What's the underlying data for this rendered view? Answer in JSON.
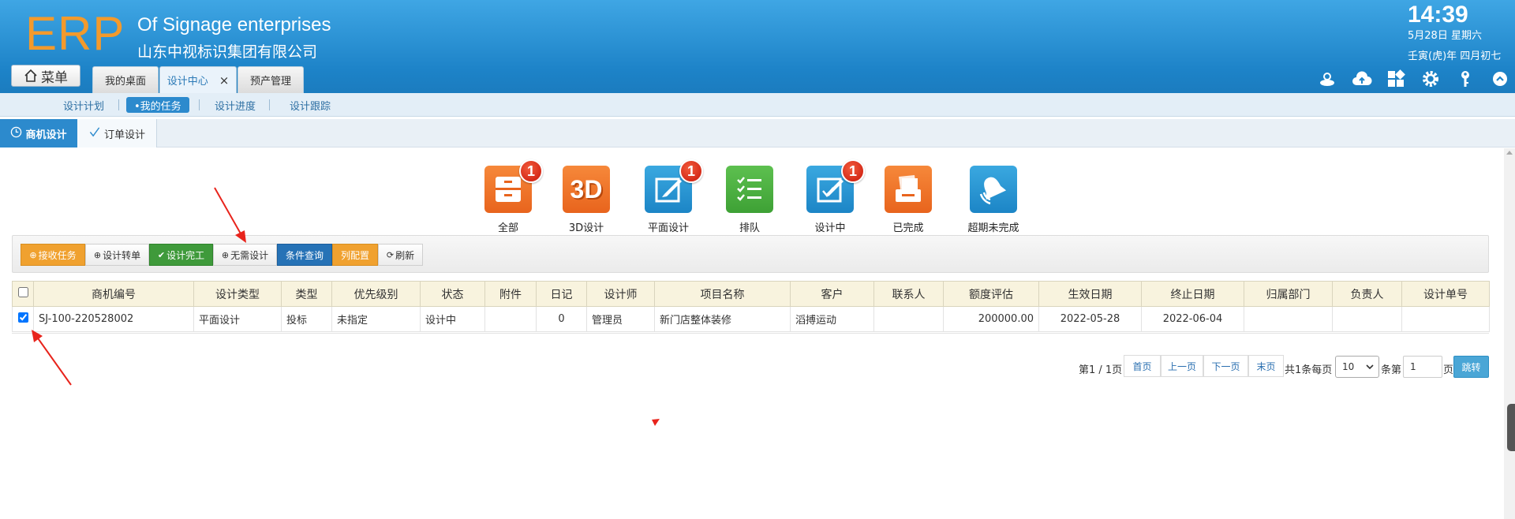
{
  "header": {
    "logo": "ERP",
    "company_en": "Of Signage enterprises",
    "company_cn": "山东中视标识集团有限公司",
    "time": "14:39",
    "date": "5月28日 星期六",
    "lunar": "壬寅(虎)年 四月初七"
  },
  "menu_button": {
    "label": "菜单"
  },
  "tabs": [
    {
      "label": "我的桌面"
    },
    {
      "label": "设计中心",
      "close": "×"
    },
    {
      "label": "预产管理"
    }
  ],
  "subnav": [
    {
      "label": "设计计划"
    },
    {
      "label": "•我的任务"
    },
    {
      "label": "设计进度"
    },
    {
      "label": "设计跟踪"
    }
  ],
  "type_tabs": [
    {
      "label": "商机设计"
    },
    {
      "label": "订单设计"
    }
  ],
  "categories": [
    {
      "label": "全部",
      "badge": "1"
    },
    {
      "label": "3D设计",
      "icon_text": "3D"
    },
    {
      "label": "平面设计",
      "badge": "1"
    },
    {
      "label": "排队"
    },
    {
      "label": "设计中",
      "badge": "1"
    },
    {
      "label": "已完成"
    },
    {
      "label": "超期未完成"
    }
  ],
  "toolbar": [
    {
      "label": "接收任务"
    },
    {
      "label": "设计转单"
    },
    {
      "label": "设计完工"
    },
    {
      "label": "无需设计"
    },
    {
      "label": "条件查询"
    },
    {
      "label": "列配置"
    },
    {
      "label": "刷新"
    }
  ],
  "table": {
    "headers": [
      "商机编号",
      "设计类型",
      "类型",
      "优先级别",
      "状态",
      "附件",
      "日记",
      "设计师",
      "项目名称",
      "客户",
      "联系人",
      "额度评估",
      "生效日期",
      "终止日期",
      "归属部门",
      "负责人",
      "设计单号"
    ],
    "rows": [
      {
        "id": "SJ-100-220528002",
        "design_type": "平面设计",
        "type": "投标",
        "priority": "未指定",
        "status": "设计中",
        "attachment": "",
        "diary": "0",
        "designer": "管理员",
        "project": "新门店整体装修",
        "customer": "滔搏运动",
        "contact": "",
        "amount": "200000.00",
        "start_date": "2022-05-28",
        "end_date": "2022-06-04",
        "department": "",
        "owner": "",
        "design_no": ""
      }
    ]
  },
  "pager": {
    "page_info": "第1 / 1页",
    "first": "首页",
    "prev": "上一页",
    "next": "下一页",
    "last": "末页",
    "total": "共1条每页",
    "per_page": "10",
    "per_unit": "条第",
    "page_input": "1",
    "page_unit": "页",
    "go": "跳转"
  },
  "colors": {
    "header_blue": "#1d83c8",
    "logo_orange": "#f39a2c",
    "active_blue": "#2c8acd",
    "badge_red": "#d9200f"
  }
}
